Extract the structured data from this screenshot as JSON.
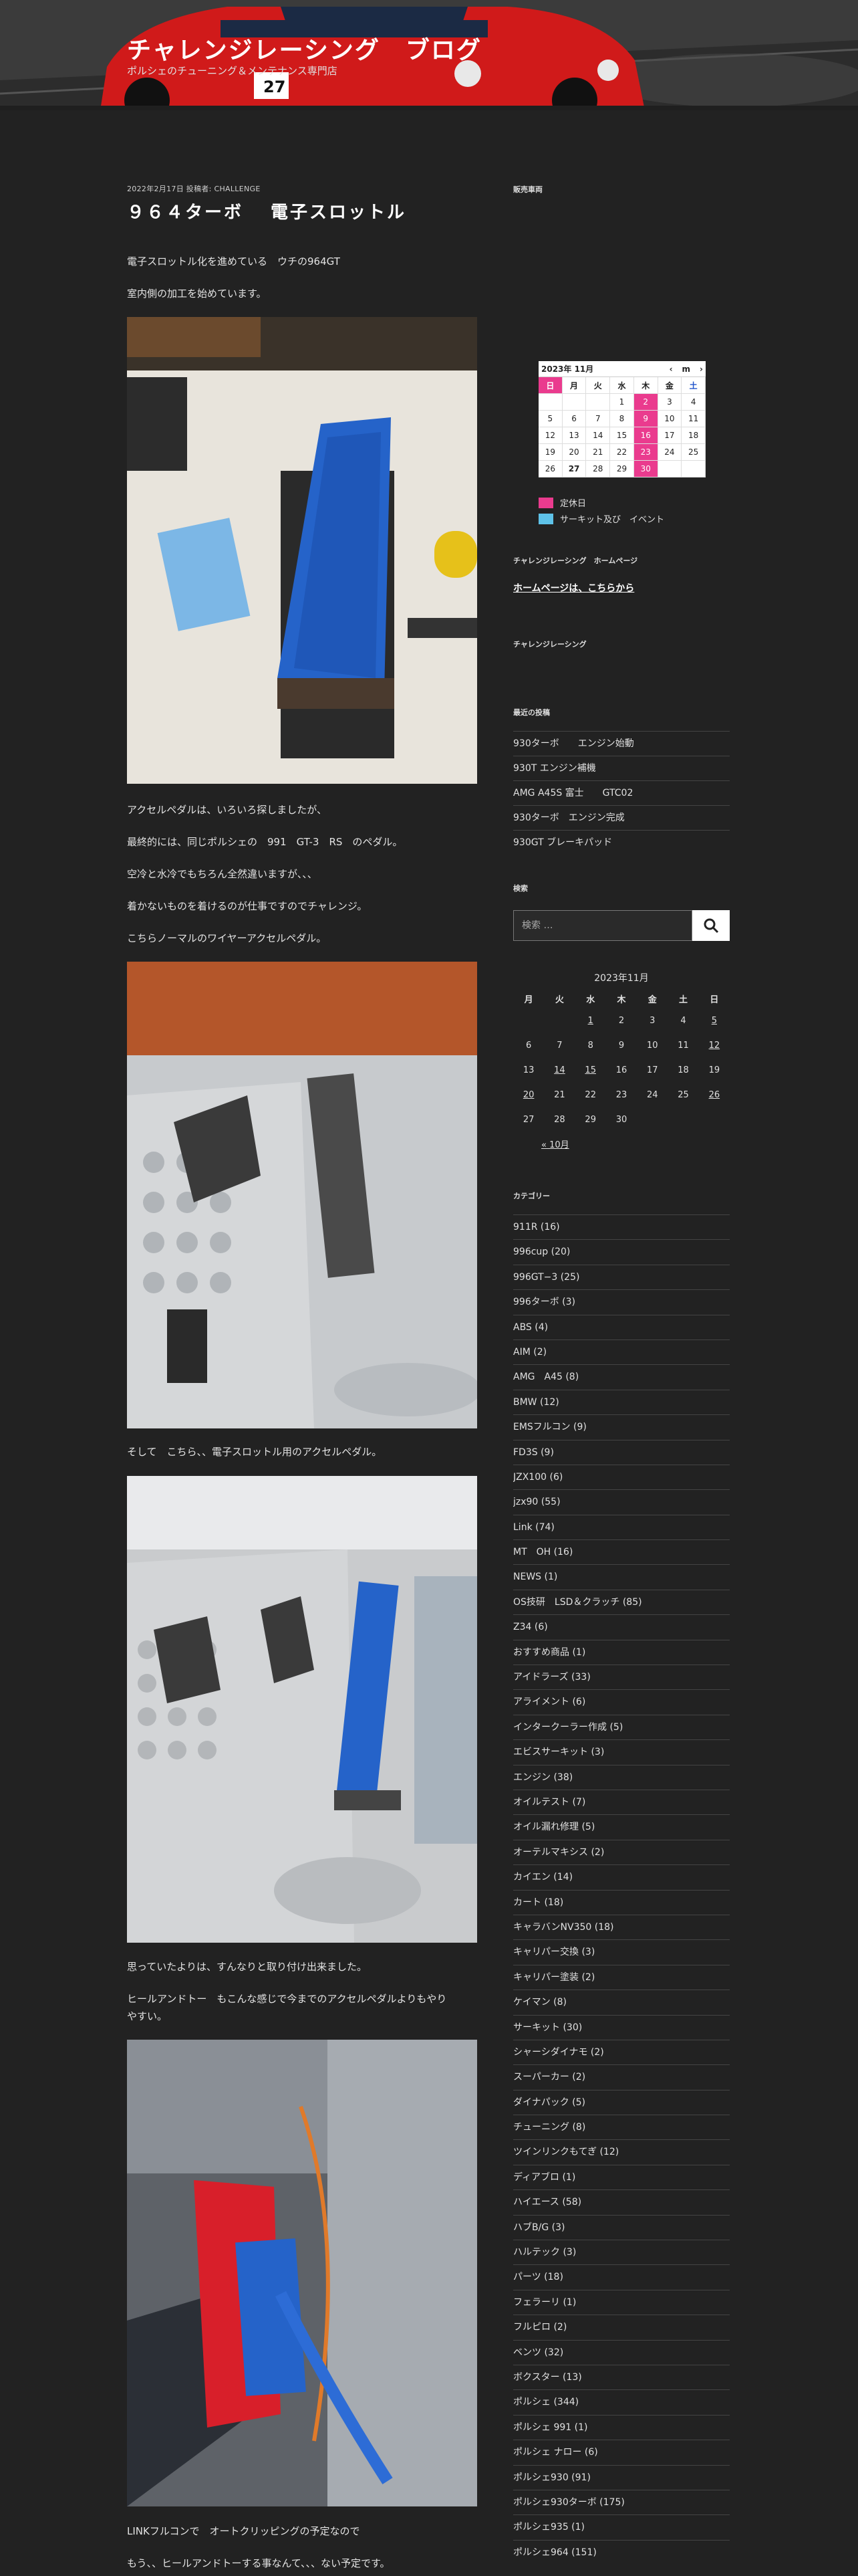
{
  "site": {
    "title": "チャレンジレーシング　ブログ",
    "description": "ポルシェのチューニング＆メンテナンス専門店"
  },
  "post": {
    "meta": "2022年2月17日 投稿者: CHALLENGE",
    "title": "９６４ターボ　 電子スロットル",
    "paragraphs": [
      "電子スロットル化を進めている　ウチの964GT",
      "室内側の加工を始めています。",
      "アクセルペダルは、いろいろ探しましたが、",
      "最終的には、同じポルシェの　991　GT-3　RS　のペダル。",
      "空冷と水冷でもちろん全然違いますが、、、",
      "着かないものを着けるのが仕事ですのでチャレンジ。",
      "こちらノーマルのワイヤーアクセルペダル。",
      "そして　こちら、、電子スロットル用のアクセルペダル。",
      "思っていたよりは、すんなりと取り付け出来ました。",
      "ヒールアンドトー　もこんな感じで今までのアクセルペダルよりもやり",
      "やすい。",
      "LINKフルコンで　オートクリッピングの予定なので",
      "もう、、ヒールアンドトーする事なんて、、、ない予定です。"
    ]
  },
  "sidebar": {
    "schedule_heading": "販売車両",
    "mini_calendar": {
      "month_label": "2023年 11月",
      "prev": "‹",
      "mode": "m",
      "next": "›",
      "weekdays": [
        "日",
        "月",
        "火",
        "水",
        "木",
        "金",
        "土"
      ],
      "rows": [
        [
          "",
          "",
          "",
          "1",
          "2",
          "3",
          "4"
        ],
        [
          "5",
          "6",
          "7",
          "8",
          "9",
          "10",
          "11"
        ],
        [
          "12",
          "13",
          "14",
          "15",
          "16",
          "17",
          "18"
        ],
        [
          "19",
          "20",
          "21",
          "22",
          "23",
          "24",
          "25"
        ],
        [
          "26",
          "27",
          "28",
          "29",
          "30",
          "",
          ""
        ]
      ],
      "holidays_label": "定休日",
      "events_label": "サーキット及び　イベント",
      "holiday_color": "#ea3b8e",
      "event_color": "#5ec2e8"
    },
    "homepage_heading": "チャレンジレーシング　ホームページ",
    "homepage_link": "ホームページは、こちらから",
    "cr_heading": "チャレンジレーシング",
    "recent_heading": "最近の投稿",
    "recent_posts": [
      "930ターボ　　エンジン始動",
      "930T エンジン補機",
      "AMG A45S 富士　　GTC02",
      "930ターボ　エンジン完成",
      "930GT ブレーキパッド"
    ],
    "search_heading": "検索",
    "search_placeholder": "検索 …",
    "calendar": {
      "title": "2023年11月",
      "weekdays": [
        "月",
        "火",
        "水",
        "木",
        "金",
        "土",
        "日"
      ],
      "rows": [
        [
          "",
          "",
          "1",
          "2",
          "3",
          "4",
          "5"
        ],
        [
          "6",
          "7",
          "8",
          "9",
          "10",
          "11",
          "12"
        ],
        [
          "13",
          "14",
          "15",
          "16",
          "17",
          "18",
          "19"
        ],
        [
          "20",
          "21",
          "22",
          "23",
          "24",
          "25",
          "26"
        ],
        [
          "27",
          "28",
          "29",
          "30",
          "",
          "",
          ""
        ]
      ],
      "linked_days": [
        "1",
        "5",
        "12",
        "14",
        "15",
        "20",
        "26"
      ],
      "prev_link": "« 10月"
    },
    "categories_heading": "カテゴリー",
    "categories": [
      "911R (16)",
      "996cup (20)",
      "996GT−3 (25)",
      "996ターボ (3)",
      "ABS (4)",
      "AIM (2)",
      "AMG　A45 (8)",
      "BMW (12)",
      "EMSフルコン (9)",
      "FD3S (9)",
      "JZX100 (6)",
      "jzx90 (55)",
      "Link (74)",
      "MT　OH (16)",
      "NEWS (1)",
      "OS技研　LSD＆クラッチ (85)",
      "Z34 (6)",
      "おすすめ商品 (1)",
      "アイドラーズ (33)",
      "アライメント (6)",
      "インタークーラー作成 (5)",
      "エビスサーキット (3)",
      "エンジン (38)",
      "オイルテスト (7)",
      "オイル漏れ修理 (5)",
      "オーテルマキシス (2)",
      "カイエン (14)",
      "カート (18)",
      "キャラバンNV350 (18)",
      "キャリパー交換 (3)",
      "キャリパー塗装 (2)",
      "ケイマン (8)",
      "サーキット (30)",
      "シャーシダイナモ (2)",
      "スーパーカー (2)",
      "ダイナパック (5)",
      "チューニング (8)",
      "ツインリンクもてぎ (12)",
      "ディアブロ (1)",
      "ハイエース (58)",
      "ハブB/G (3)",
      "ハルテック (3)",
      "パーツ (18)",
      "フェラーリ (1)",
      "フルピロ (2)",
      "ベンツ (32)",
      "ボクスター (13)",
      "ポルシェ (344)",
      "ポルシェ 991 (1)",
      "ポルシェ ナロー (6)",
      "ポルシェ930 (91)",
      "ポルシェ930ターボ (175)",
      "ポルシェ935 (1)",
      "ポルシェ964 (151)"
    ]
  },
  "colors": {
    "background": "#222222",
    "car_red": "#d01a1a",
    "pedal_blue": "#2563c9"
  }
}
